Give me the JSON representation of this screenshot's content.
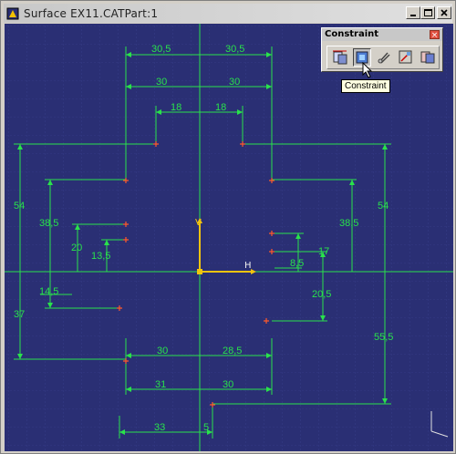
{
  "window": {
    "title": "Surface EX11.CATPart:1",
    "minimize_icon": "minimize-icon",
    "maximize_icon": "maximize-icon",
    "close_icon": "close-icon"
  },
  "toolbar": {
    "title": "Constraint",
    "close_label": "×",
    "buttons": [
      "constraint-icon",
      "contact-constraint-icon",
      "fix-together-icon",
      "auto-constraint-icon",
      "animate-constraint-icon"
    ]
  },
  "tooltip": {
    "text": "Constraint"
  },
  "colors": {
    "background": "#2a2f74",
    "dimension": "#29e24b",
    "axis": "#f1c40f",
    "point": "#ff5a2a",
    "grid": "#3a4090"
  },
  "axes": {
    "h_label": "H",
    "v_label": "V"
  },
  "dimensions": {
    "d_30_5_left": "30,5",
    "d_30_5_right": "30,5",
    "d_30_left": "30",
    "d_30_right": "30",
    "d_18_left": "18",
    "d_18_right": "18",
    "d_54_left": "54",
    "d_54_right": "54",
    "d_38_5_left": "38,5",
    "d_38_5_right": "38,5",
    "d_20": "20",
    "d_13_5": "13,5",
    "d_17": "17",
    "d_8_5": "8,5",
    "d_14_5": "14,5",
    "d_20_5": "20,5",
    "d_37": "37",
    "d_55_5": "55,5",
    "d_30_lower": "30",
    "d_28_5": "28,5",
    "d_31": "31",
    "d_30_lower_right": "30",
    "d_33": "33",
    "d_5": "5"
  }
}
